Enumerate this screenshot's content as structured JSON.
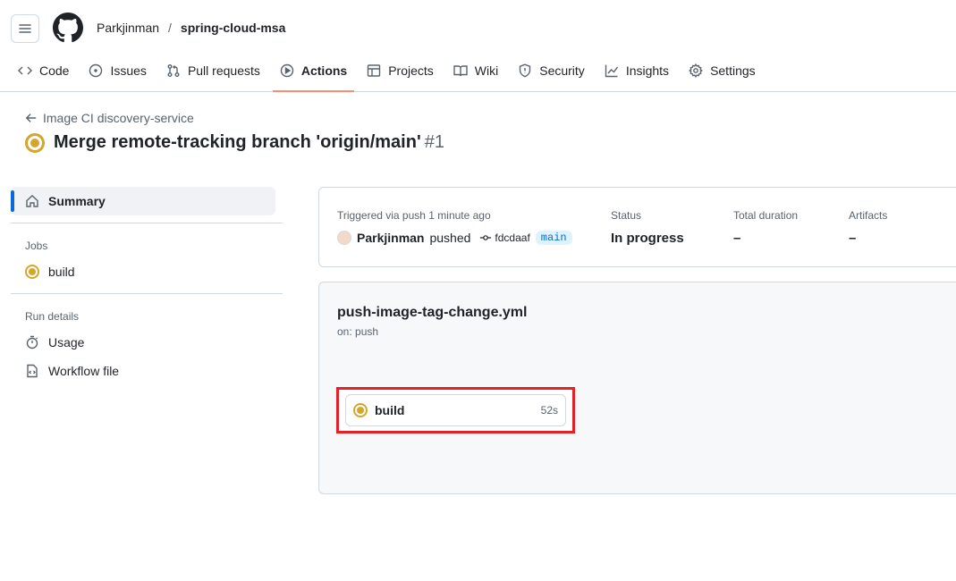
{
  "header": {
    "owner": "Parkjinman",
    "separator": "/",
    "repo": "spring-cloud-msa"
  },
  "tabs": [
    {
      "label": "Code",
      "icon": "code-icon"
    },
    {
      "label": "Issues",
      "icon": "issue-icon"
    },
    {
      "label": "Pull requests",
      "icon": "pull-request-icon"
    },
    {
      "label": "Actions",
      "icon": "play-icon",
      "active": true
    },
    {
      "label": "Projects",
      "icon": "table-icon"
    },
    {
      "label": "Wiki",
      "icon": "book-icon"
    },
    {
      "label": "Security",
      "icon": "shield-icon"
    },
    {
      "label": "Insights",
      "icon": "graph-icon"
    },
    {
      "label": "Settings",
      "icon": "gear-icon"
    }
  ],
  "run": {
    "back_label": "Image CI discovery-service",
    "title": "Merge remote-tracking branch 'origin/main'",
    "number": "#1"
  },
  "sidebar": {
    "summary": "Summary",
    "jobs_heading": "Jobs",
    "job_label": "build",
    "run_details_heading": "Run details",
    "usage": "Usage",
    "workflow_file": "Workflow file"
  },
  "summary": {
    "triggered_label": "Triggered via push 1 minute ago",
    "actor": "Parkjinman",
    "action": "pushed",
    "commit": "fdcdaaf",
    "branch": "main",
    "status_label": "Status",
    "status_value": "In progress",
    "duration_label": "Total duration",
    "duration_value": "–",
    "artifacts_label": "Artifacts",
    "artifacts_value": "–"
  },
  "workflow": {
    "file": "push-image-tag-change.yml",
    "trigger": "on: push",
    "job": {
      "name": "build",
      "duration": "52s"
    }
  },
  "colors": {
    "accent": "#0969da",
    "in_progress": "#d4a72c",
    "active_tab_underline": "#fd8c73",
    "highlight_box": "#e32227"
  }
}
